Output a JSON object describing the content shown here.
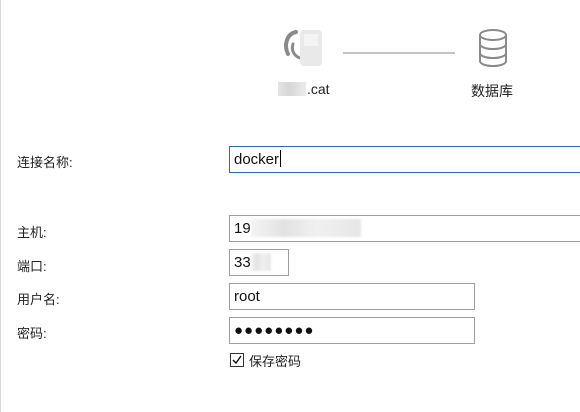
{
  "diagram": {
    "app_label_suffix": ".cat",
    "database_label": "数据库",
    "app_icon": "app-logo-icon",
    "database_icon": "database-icon"
  },
  "form": {
    "connection_name": {
      "label": "连接名称:",
      "value": "docker"
    },
    "host": {
      "label": "主机:",
      "value_prefix": "19"
    },
    "port": {
      "label": "端口:",
      "value_prefix": "33"
    },
    "username": {
      "label": "用户名:",
      "value": "root"
    },
    "password": {
      "label": "密码:",
      "masked_value": "●●●●●●●●"
    },
    "save_password": {
      "label": "保存密码",
      "checked": true
    }
  },
  "colors": {
    "focus_border": "#2b6cb0",
    "field_border": "#9e9e9e",
    "connector": "#c4c4c4",
    "icon_gray": "#8a8a8a"
  }
}
